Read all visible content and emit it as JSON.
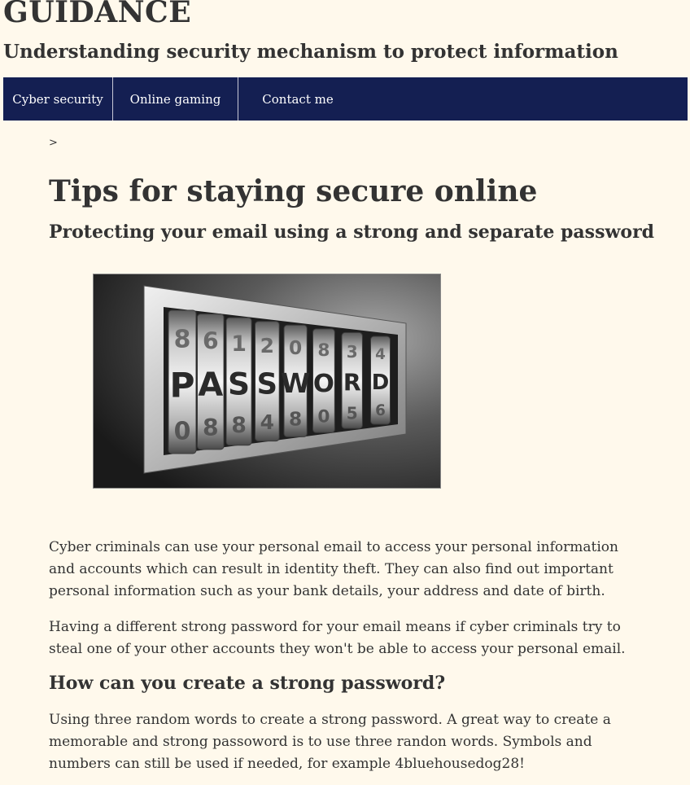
{
  "header": {
    "site_title": "GUIDANCE",
    "site_subtitle": "Understanding security mechanism to protect information"
  },
  "nav": {
    "items": [
      {
        "label": "Cyber security"
      },
      {
        "label": "Online gaming"
      },
      {
        "label": "Contact me"
      }
    ]
  },
  "breadcrumb": {
    "separator": ">"
  },
  "article": {
    "title": "Tips for staying secure online",
    "subheading": "Protecting your email using a strong and separate password",
    "image": {
      "top_row": [
        "8",
        "6",
        "1",
        "2",
        "0",
        "8",
        "3",
        "4"
      ],
      "middle_row": [
        "P",
        "A",
        "S",
        "S",
        "W",
        "O",
        "R",
        "D"
      ],
      "bottom_row": [
        "0",
        "8",
        "8",
        "4",
        "8",
        "0",
        "5",
        "6"
      ]
    },
    "paragraph_1": "Cyber criminals can use your personal email to access your personal information and accounts which can result in identity theft. They can also find out important personal information such as your bank details, your address and date of birth.",
    "paragraph_2": "Having a different strong password for your email means if cyber criminals try to steal one of your other accounts they won't be able to access your personal email.",
    "section_heading": "How can you create a strong password?",
    "paragraph_3": "Using three random words to create a strong password. A great way to create a memorable and strong passoword is to use three randon words. Symbols and numbers can still be used if needed, for example 4bluehousedog28!"
  },
  "colors": {
    "background": "#fff9ec",
    "nav_background": "#141f52",
    "text": "#333333"
  }
}
